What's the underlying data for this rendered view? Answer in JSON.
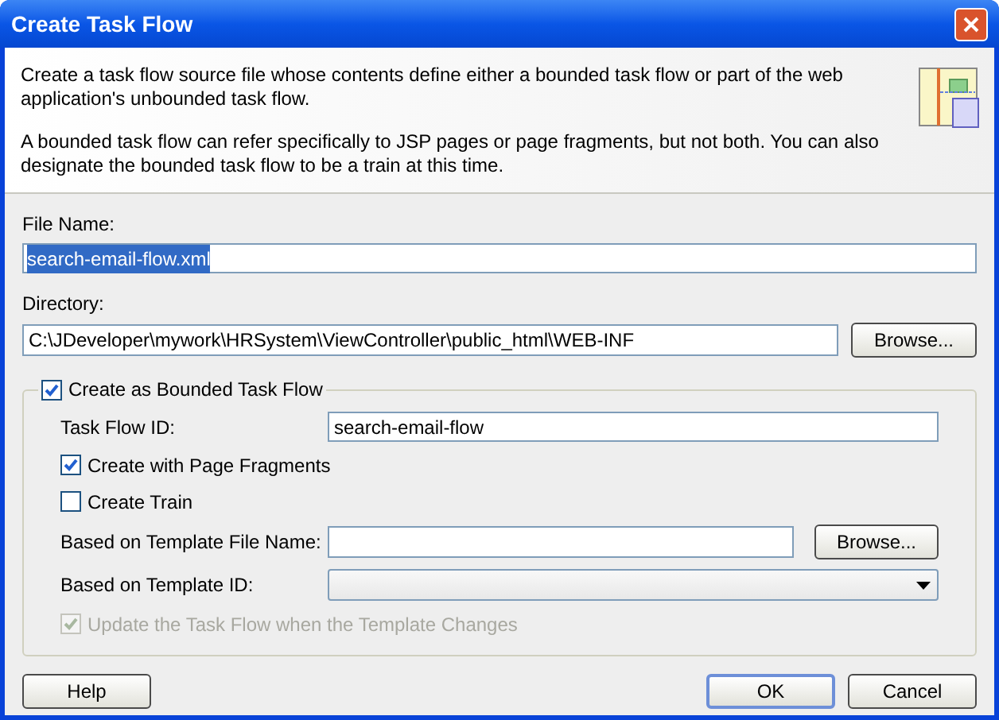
{
  "window": {
    "title": "Create Task Flow"
  },
  "description": [
    "Create a task flow source file whose contents define either a bounded task flow or part of the web application's unbounded task flow.",
    "A bounded task flow can refer specifically to JSP pages or page fragments, but not both.  You can also designate the bounded task flow to be a train at this time."
  ],
  "file_name": {
    "label": "File Name:",
    "value": "search-email-flow.xml",
    "selected": true
  },
  "directory": {
    "label": "Directory:",
    "value": "C:\\JDeveloper\\mywork\\HRSystem\\ViewController\\public_html\\WEB-INF",
    "browse": "Browse..."
  },
  "bounded_group": {
    "label": "Create as Bounded Task Flow",
    "checked": true,
    "rows": [
      {
        "kind": "text",
        "label": "Task Flow ID:",
        "value": "search-email-flow"
      },
      {
        "kind": "checkbox",
        "label": "Create with Page Fragments",
        "checked": true,
        "disabled": false
      },
      {
        "kind": "checkbox",
        "label": "Create Train",
        "checked": false,
        "disabled": false
      },
      {
        "kind": "file",
        "label": "Based on Template File Name:",
        "browse": "Browse..."
      },
      {
        "kind": "dropdown",
        "label": "Based on Template ID:"
      },
      {
        "kind": "checkbox",
        "label": "Update the Task Flow when the Template Changes",
        "checked": true,
        "disabled": true
      }
    ]
  },
  "buttons": [
    {
      "label": "Help",
      "default": false
    },
    {
      "label": "OK",
      "default": true
    },
    {
      "label": "Cancel",
      "default": false
    }
  ]
}
